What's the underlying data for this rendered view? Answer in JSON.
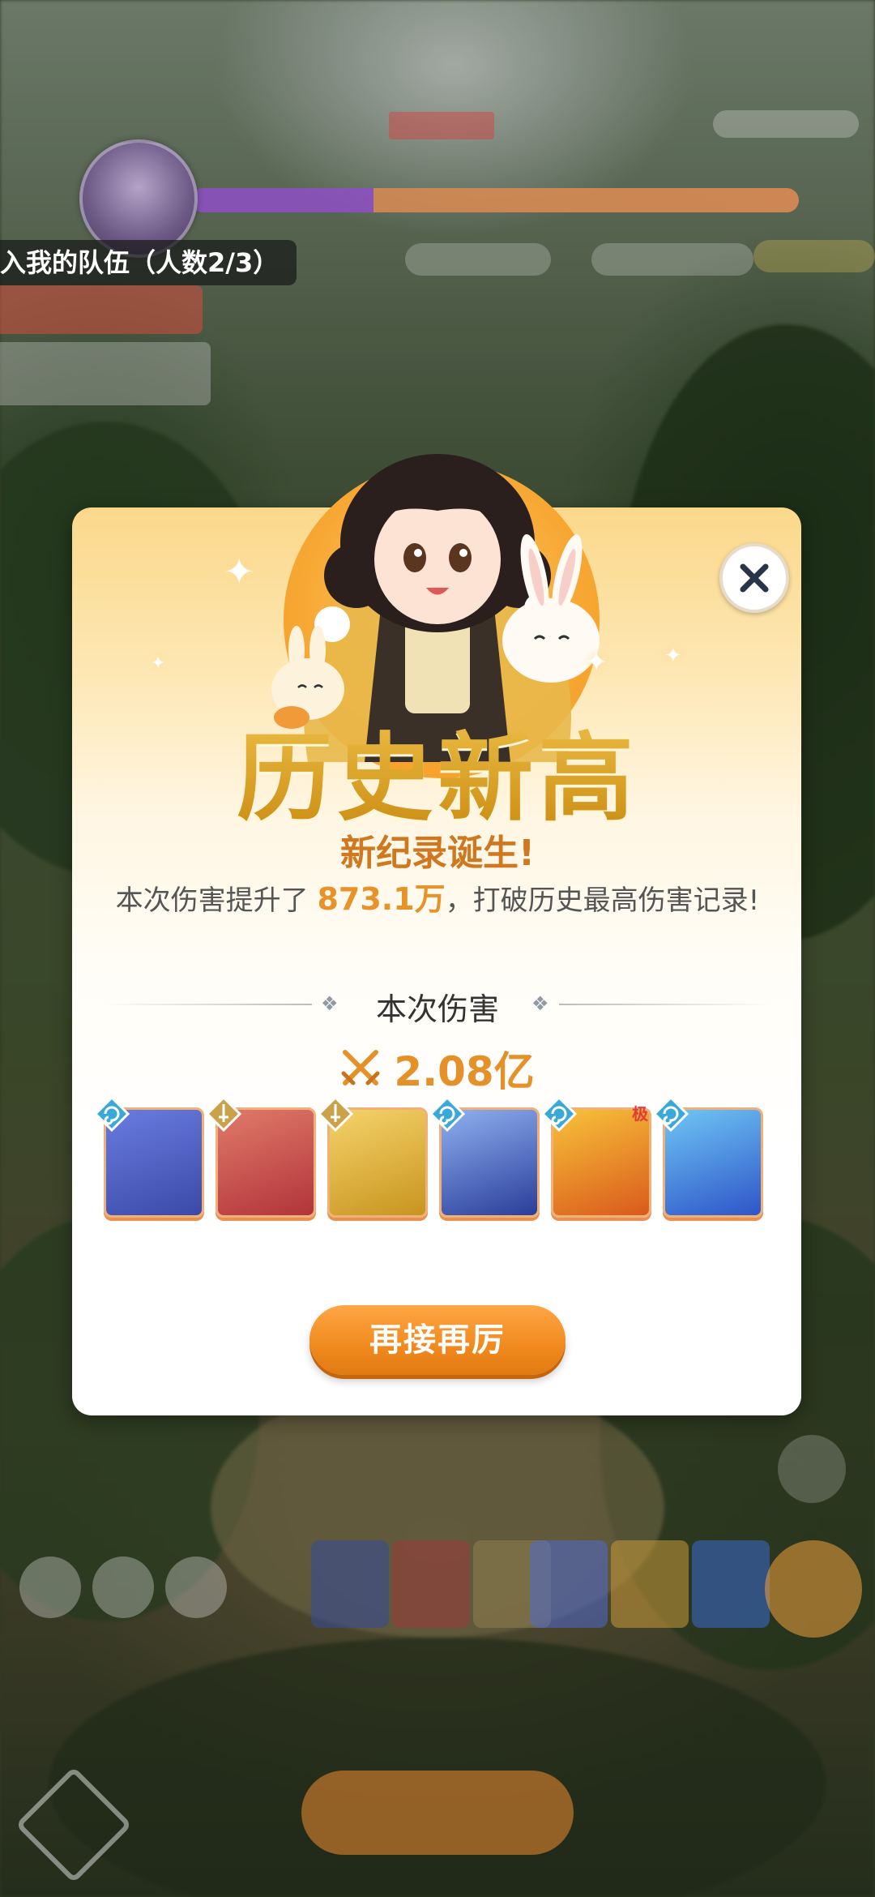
{
  "hud": {
    "team_banner": "入我的队伍（人数2/3）"
  },
  "popup": {
    "title": "历史新高",
    "subtitle": "新纪录诞生!",
    "description_prefix": "本次伤害提升了",
    "description_value": "873.1万",
    "description_suffix": "，打破历史最高伤害记录!",
    "section_title": "本次伤害",
    "damage_value": "2.08亿",
    "skills": [
      {
        "name": "skill-1",
        "badge": "swirl",
        "colors": [
          "#3b4aa8",
          "#6a7ce0"
        ],
        "tag": ""
      },
      {
        "name": "skill-2",
        "badge": "sword",
        "colors": [
          "#b2343a",
          "#e07a6a"
        ],
        "tag": ""
      },
      {
        "name": "skill-3",
        "badge": "sword",
        "colors": [
          "#c8941f",
          "#f5d36a"
        ],
        "tag": ""
      },
      {
        "name": "skill-4",
        "badge": "swirl",
        "colors": [
          "#2a3e9a",
          "#8fb0f0"
        ],
        "tag": ""
      },
      {
        "name": "skill-5",
        "badge": "swirl",
        "colors": [
          "#d95a1c",
          "#f8c23a"
        ],
        "tag": "极"
      },
      {
        "name": "skill-6",
        "badge": "swirl",
        "colors": [
          "#2e55c8",
          "#6fc6f5"
        ],
        "tag": ""
      }
    ],
    "button_label": "再接再厉",
    "close_icon": "close-icon"
  }
}
